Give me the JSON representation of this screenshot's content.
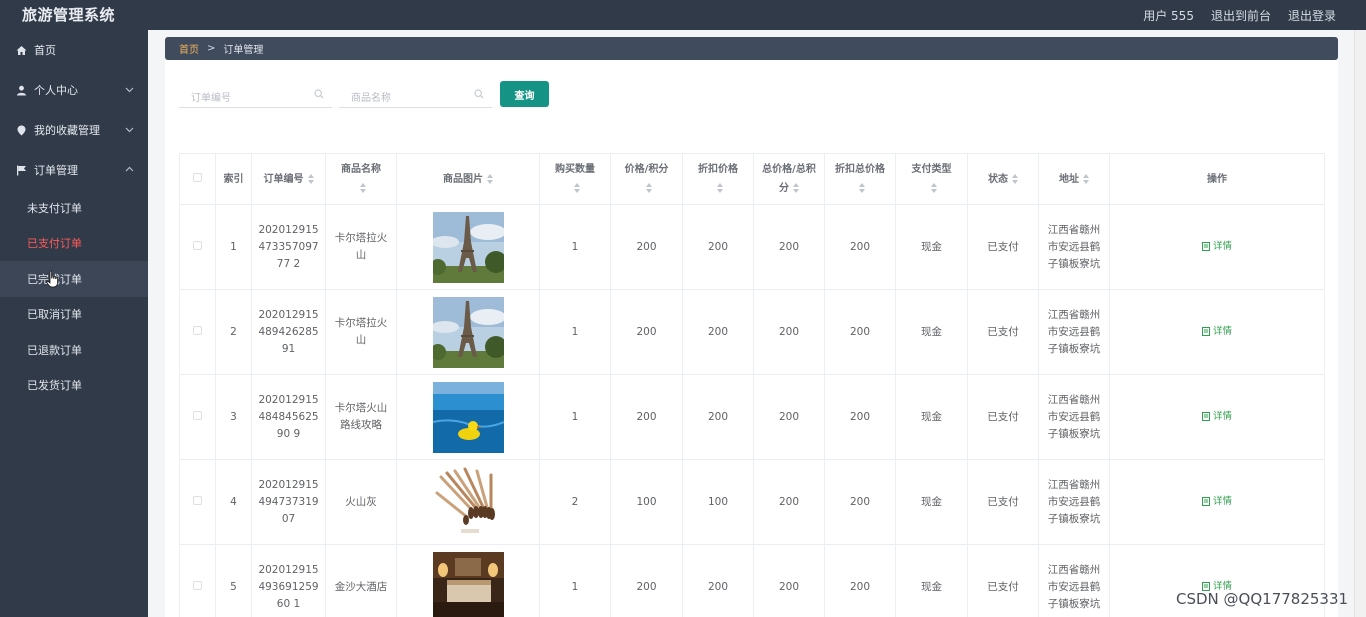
{
  "app": {
    "title": "旅游管理系统"
  },
  "topbar": {
    "user": "用户 555",
    "back_to_front": "退出到前台",
    "logout": "退出登录"
  },
  "sidebar": {
    "home": "首页",
    "personal": "个人中心",
    "favorites": "我的收藏管理",
    "orders": "订单管理",
    "sub": [
      "未支付订单",
      "已支付订单",
      "已完成订单",
      "已取消订单",
      "已退款订单",
      "已发货订单"
    ]
  },
  "breadcrumb": {
    "home": "首页",
    "sep": ">",
    "current": "订单管理"
  },
  "search": {
    "order_no_placeholder": "订单编号",
    "product_placeholder": "商品名称",
    "query_label": "查询"
  },
  "table": {
    "headers": [
      "索引",
      "订单编号",
      "商品名称",
      "商品图片",
      "购买数量",
      "价格/积分",
      "折扣价格",
      "总价格/总积分",
      "折扣总价格",
      "支付类型",
      "状态",
      "地址",
      "操作"
    ],
    "detail_label": "详情",
    "rows": [
      {
        "index": "1",
        "order_no": "20201291547335709777 2",
        "product": "卡尔塔拉火山",
        "image": "eiffel-tower",
        "qty": "1",
        "price": "200",
        "discount_price": "200",
        "total": "200",
        "discount_total": "200",
        "pay_type": "现金",
        "status": "已支付",
        "address": "江西省赣州市安远县鹤子镇板寮坑"
      },
      {
        "index": "2",
        "order_no": "20201291548942628591",
        "product": "卡尔塔拉火山",
        "image": "eiffel-tower",
        "qty": "1",
        "price": "200",
        "discount_price": "200",
        "total": "200",
        "discount_total": "200",
        "pay_type": "现金",
        "status": "已支付",
        "address": "江西省赣州市安远县鹤子镇板寮坑"
      },
      {
        "index": "3",
        "order_no": "20201291548484562590 9",
        "product": "卡尔塔火山路线攻略",
        "image": "pool-duck",
        "qty": "1",
        "price": "200",
        "discount_price": "200",
        "total": "200",
        "discount_total": "200",
        "pay_type": "现金",
        "status": "已支付",
        "address": "江西省赣州市安远县鹤子镇板寮坑"
      },
      {
        "index": "4",
        "order_no": "20201291549473731907",
        "product": "火山灰",
        "image": "brushes",
        "qty": "2",
        "price": "100",
        "discount_price": "100",
        "total": "200",
        "discount_total": "200",
        "pay_type": "现金",
        "status": "已支付",
        "address": "江西省赣州市安远县鹤子镇板寮坑"
      },
      {
        "index": "5",
        "order_no": "20201291549369125960 1",
        "product": "金沙大酒店",
        "image": "hotel-room",
        "qty": "1",
        "price": "200",
        "discount_price": "200",
        "total": "200",
        "discount_total": "200",
        "pay_type": "现金",
        "status": "已支付",
        "address": "江西省赣州市安远县鹤子镇板寮坑"
      }
    ]
  },
  "watermark": "CSDN @QQ177825331",
  "colors": {
    "sidebar_bg": "#303a48",
    "accent": "#159485",
    "active_sub": "#ff5a5a",
    "crumb_home": "#f0b35a"
  }
}
